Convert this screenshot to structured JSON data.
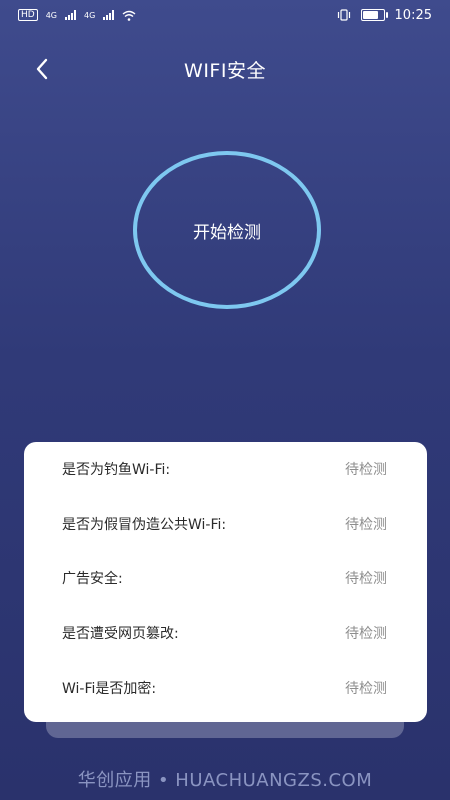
{
  "status_bar": {
    "badge": "HD",
    "net1": "4G",
    "net2": "4G",
    "time": "10:25"
  },
  "header": {
    "title": "WIFI安全",
    "back_icon": "chevron-left-icon"
  },
  "scan": {
    "label": "开始检测",
    "ring_color": "#7ec8f0"
  },
  "checks": [
    {
      "label": "是否为钓鱼Wi-Fi:",
      "status": "待检测"
    },
    {
      "label": "是否为假冒伪造公共Wi-Fi:",
      "status": "待检测"
    },
    {
      "label": "广告安全:",
      "status": "待检测"
    },
    {
      "label": "是否遭受网页篡改:",
      "status": "待检测"
    },
    {
      "label": "Wi-Fi是否加密:",
      "status": "待检测"
    }
  ],
  "watermark": "华创应用 • HUACHUANGZS.COM"
}
